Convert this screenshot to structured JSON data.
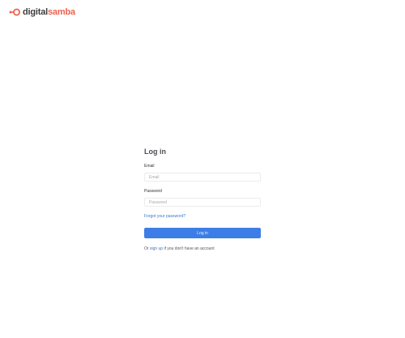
{
  "brand": {
    "word1": "digital",
    "word2": "samba",
    "accent_color": "#f0624f",
    "dark_color": "#3b3b3b"
  },
  "login": {
    "title": "Log in",
    "email_label": "Email",
    "email_placeholder": "Email",
    "password_label": "Password",
    "password_placeholder": "Password",
    "forgot_link": "Forgot your password?",
    "submit_label": "Log in",
    "signup_prefix": "Or",
    "signup_link": "sign up",
    "signup_suffix": "if you don't have an account"
  },
  "colors": {
    "button": "#3d7ee6",
    "link": "#3a78c8"
  }
}
